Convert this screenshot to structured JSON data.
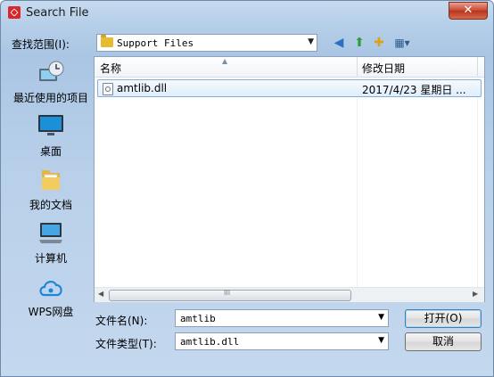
{
  "window": {
    "title": "Search File",
    "close_label": "✕"
  },
  "look_in": {
    "label": "查找范围(I):",
    "value": "Support Files"
  },
  "toolbar": {
    "back_icon": "◀",
    "up_icon": "⬆",
    "new_folder_icon": "✚",
    "view_icon": "▦▾"
  },
  "places": [
    {
      "label": "最近使用的项目"
    },
    {
      "label": "桌面"
    },
    {
      "label": "我的文档"
    },
    {
      "label": "计算机"
    },
    {
      "label": "WPS网盘"
    }
  ],
  "file_list": {
    "columns": {
      "name": "名称",
      "date": "修改日期"
    },
    "rows": [
      {
        "name": "amtlib.dll",
        "date": "2017/4/23 星期日 ..."
      }
    ],
    "scroll_grip": "III"
  },
  "filename": {
    "label": "文件名(N):",
    "value": "amtlib"
  },
  "filetype": {
    "label": "文件类型(T):",
    "value": "amtlib.dll"
  },
  "buttons": {
    "open": "打开(O)",
    "cancel": "取消"
  }
}
